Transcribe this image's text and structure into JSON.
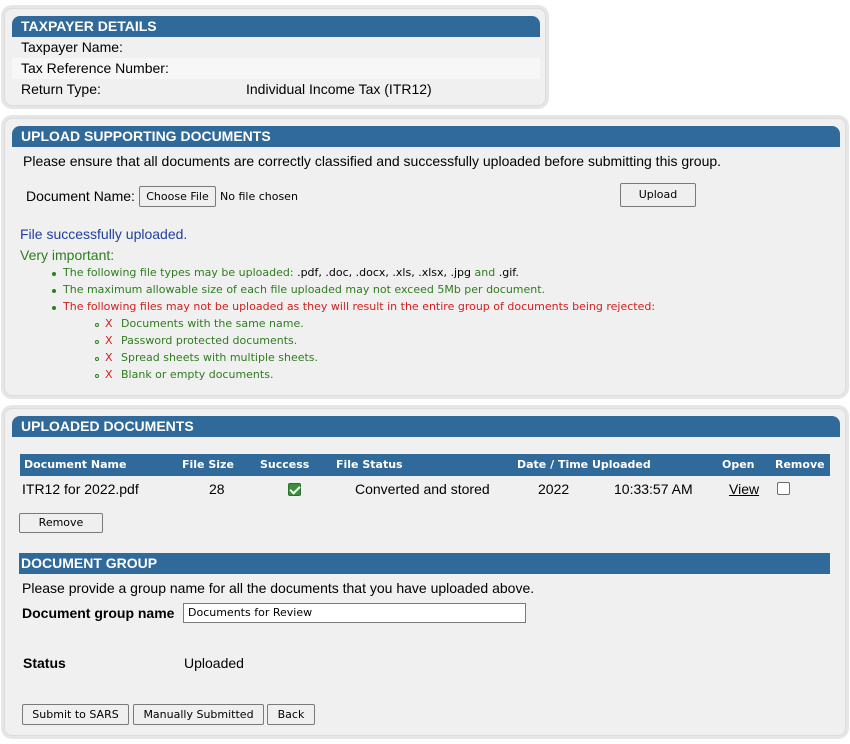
{
  "taxpayer": {
    "title": "TAXPAYER DETAILS",
    "rows": [
      {
        "label": "Taxpayer Name:",
        "value": ""
      },
      {
        "label": "Tax Reference Number:",
        "value": ""
      },
      {
        "label": "Return Type:",
        "value": "Individual Income Tax (ITR12)"
      }
    ]
  },
  "upload": {
    "title": "UPLOAD SUPPORTING DOCUMENTS",
    "instruction": "Please ensure that all documents are correctly classified and successfully uploaded before submitting this group.",
    "doc_name_label": "Document Name:",
    "choose_file_label": "Choose File",
    "no_file_text": "No file chosen",
    "upload_button": "Upload",
    "success_message": "File successfully uploaded.",
    "very_important": "Very important:",
    "rule1_prefix": "The following file types may be uploaded: ",
    "rule1_types": ".pdf, .doc, .docx, .xls, .xlsx, .jpg",
    "rule1_and": " and ",
    "rule1_last": ".gif.",
    "rule2": "The maximum allowable size of each file uploaded may not exceed 5Mb per document.",
    "rule3": "The following files may not be uploaded as they will result in the entire group of documents being rejected:",
    "x_mark": "X",
    "rejected": [
      "Documents with the same name.",
      "Password protected documents.",
      "Spread sheets with multiple sheets.",
      "Blank or empty documents."
    ]
  },
  "uploaded": {
    "title": "UPLOADED DOCUMENTS",
    "columns": {
      "name": "Document Name",
      "size": "File Size",
      "success": "Success",
      "status": "File Status",
      "date": "Date / Time Uploaded",
      "open": "Open",
      "remove": "Remove"
    },
    "rows": [
      {
        "name": "ITR12 for 2022.pdf",
        "size": "28",
        "success": true,
        "status": "Converted and stored",
        "date": "2022",
        "time": "10:33:57 AM",
        "open": "View",
        "remove": false
      }
    ],
    "remove_button": "Remove"
  },
  "group": {
    "title": "DOCUMENT GROUP",
    "instruction": "Please provide a group name for all the documents that you have uploaded above.",
    "name_label": "Document group name",
    "name_value": "Documents for Review",
    "status_label": "Status",
    "status_value": "Uploaded"
  },
  "actions": {
    "submit": "Submit to SARS",
    "manual": "Manually Submitted",
    "back": "Back"
  },
  "colors": {
    "header": "#2f6a9a",
    "success": "#2e7d1e",
    "warning": "#d32020",
    "info": "#1f3fa0"
  }
}
